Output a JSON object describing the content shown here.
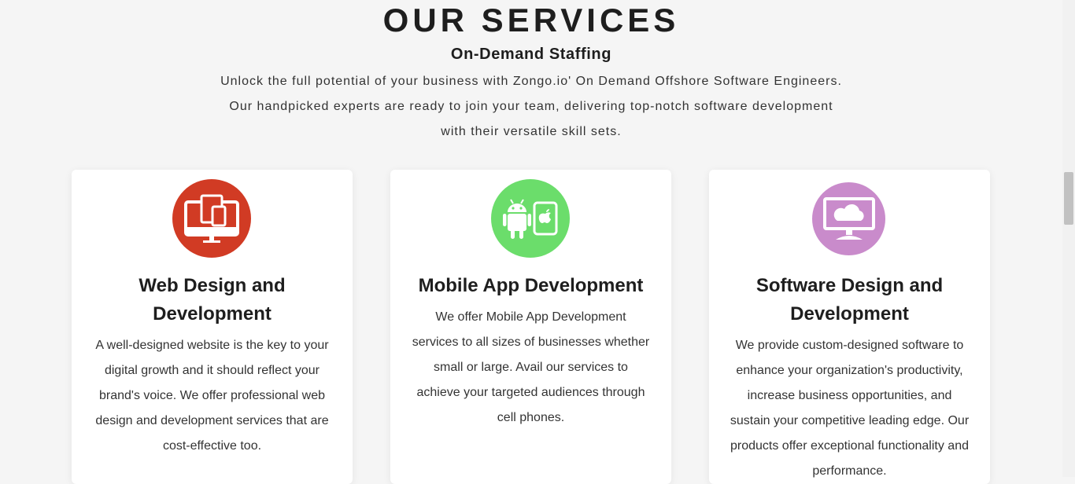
{
  "section": {
    "title": "OUR SERVICES",
    "subtitle": "On-Demand Staffing",
    "intro": "Unlock the full potential of your business with Zongo.io' On Demand Offshore Software Engineers. Our handpicked experts are ready to join your team, delivering top-notch software development with their versatile skill sets."
  },
  "cards": [
    {
      "icon": "devices-icon",
      "color": "#d13b24",
      "title": "Web Design and Development",
      "text": "A well-designed website is the key to your digital growth and it should reflect your brand's voice. We offer professional web design and development services that are cost-effective too."
    },
    {
      "icon": "android-apple-icon",
      "color": "#6bdd6b",
      "title": "Mobile App Development",
      "text": "We offer Mobile App Development services to all sizes of businesses whether small or large. Avail our services to achieve your targeted audiences through cell phones."
    },
    {
      "icon": "cloud-monitor-icon",
      "color": "#c98bcb",
      "title": "Software Design and Development",
      "text": "We provide custom-designed software to enhance your organization's productivity, increase business opportunities, and sustain your competitive leading edge. Our products offer exceptional functionality and performance."
    }
  ]
}
